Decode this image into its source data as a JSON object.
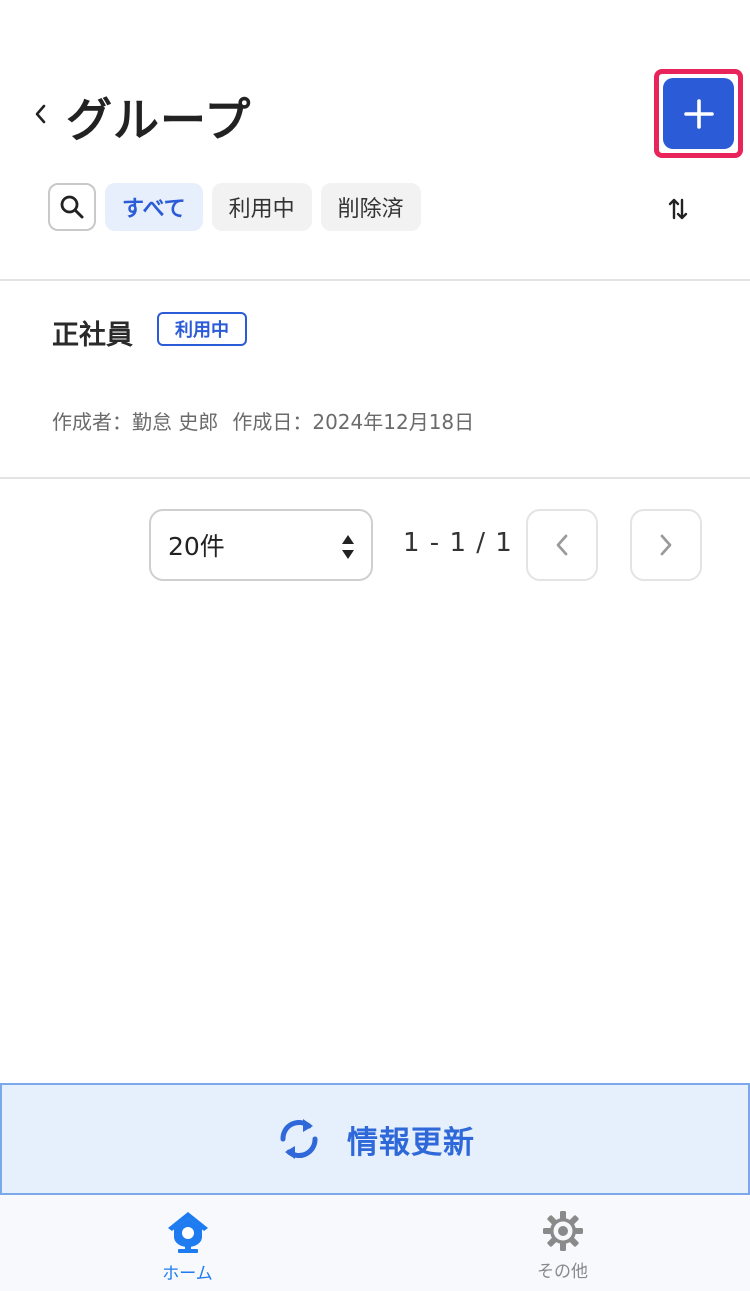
{
  "header": {
    "title": "グループ",
    "back_label": "‹",
    "add_label": "+"
  },
  "filters": {
    "chips": [
      {
        "label": "すべて",
        "active": true
      },
      {
        "label": "利用中",
        "active": false
      },
      {
        "label": "削除済",
        "active": false
      }
    ]
  },
  "list": {
    "items": [
      {
        "name": "正社員",
        "status": "利用中",
        "creator": "作成者：勤怠 史郎",
        "created": "作成日：2024年12月18日"
      }
    ]
  },
  "pagination": {
    "per_page": "20件",
    "range": "1 - 1 / 1"
  },
  "refresh": {
    "label": "情報更新"
  },
  "tabbar": {
    "tabs": [
      {
        "label": "ホーム",
        "icon": "home-icon",
        "active": true
      },
      {
        "label": "その他",
        "icon": "gear-icon",
        "active": false
      }
    ]
  },
  "colors": {
    "accent": "#2b5bd6",
    "highlight": "#e8245a",
    "tab_active": "#1e7bf0"
  }
}
